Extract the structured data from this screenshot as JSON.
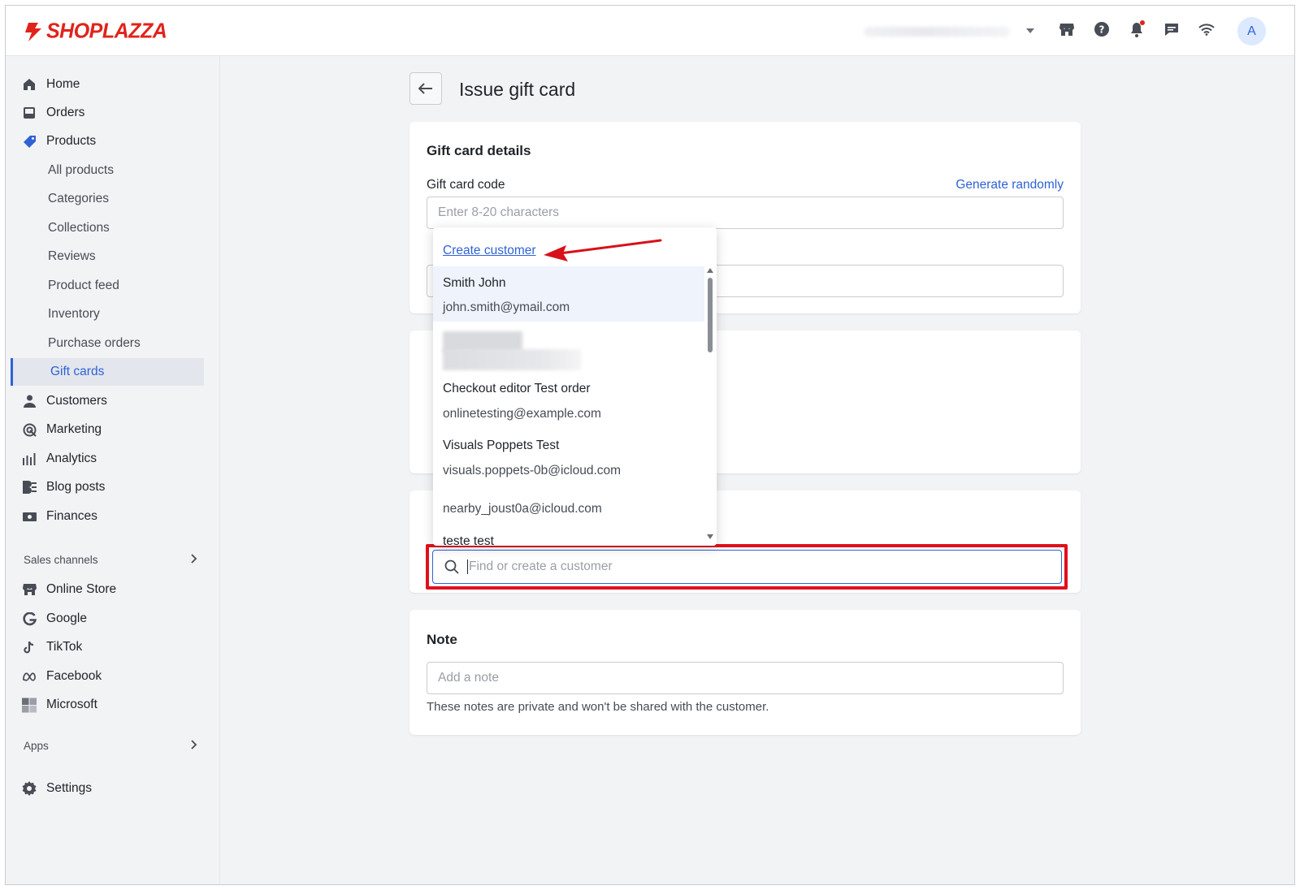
{
  "brand": {
    "name": "SHOPLAZZA",
    "color": "#e0231b"
  },
  "topbar": {
    "icons": [
      "storefront-icon",
      "help-icon",
      "bell-icon",
      "chat-icon",
      "wifi-icon"
    ],
    "avatar_initial": "A"
  },
  "sidebar": {
    "items": [
      {
        "label": "Home",
        "icon": "home-icon"
      },
      {
        "label": "Orders",
        "icon": "inbox-icon"
      },
      {
        "label": "Products",
        "icon": "tag-icon"
      }
    ],
    "product_subitems": [
      "All products",
      "Categories",
      "Collections",
      "Reviews",
      "Product feed",
      "Inventory",
      "Purchase orders",
      "Gift cards"
    ],
    "active_subitem": "Gift cards",
    "more_items": [
      {
        "label": "Customers",
        "icon": "person-icon"
      },
      {
        "label": "Marketing",
        "icon": "target-icon"
      },
      {
        "label": "Analytics",
        "icon": "bars-icon"
      },
      {
        "label": "Blog posts",
        "icon": "blog-icon"
      },
      {
        "label": "Finances",
        "icon": "finance-icon"
      }
    ],
    "sales_channels_label": "Sales channels",
    "channels": [
      {
        "label": "Online Store",
        "icon": "storefront-icon"
      },
      {
        "label": "Google",
        "icon": "google-icon"
      },
      {
        "label": "TikTok",
        "icon": "tiktok-icon"
      },
      {
        "label": "Facebook",
        "icon": "meta-icon"
      },
      {
        "label": "Microsoft",
        "icon": "microsoft-icon"
      }
    ],
    "apps_label": "Apps",
    "settings_label": "Settings"
  },
  "page": {
    "title": "Issue gift card",
    "details_card": {
      "title": "Gift card details",
      "code_label": "Gift card code",
      "generate_link": "Generate randomly",
      "code_placeholder": "Enter 8-20 characters"
    },
    "customer_search": {
      "placeholder": "Find or create a customer"
    },
    "note_card": {
      "title": "Note",
      "placeholder": "Add a note",
      "helper": "These notes are private and won't be shared with the customer."
    }
  },
  "dropdown": {
    "create_label": "Create customer",
    "customers": [
      {
        "name": "Smith John",
        "email": "john.smith@ymail.com"
      },
      {
        "name": "Checkout editor Test order",
        "email": "onlinetesting@example.com"
      },
      {
        "name": "Visuals Poppets Test",
        "email": "visuals.poppets-0b@icloud.com"
      },
      {
        "name": "",
        "email": "nearby_joust0a@icloud.com"
      },
      {
        "name": "teste test",
        "email": ""
      }
    ]
  },
  "annotation": {
    "highlight_color": "#e0101b"
  }
}
